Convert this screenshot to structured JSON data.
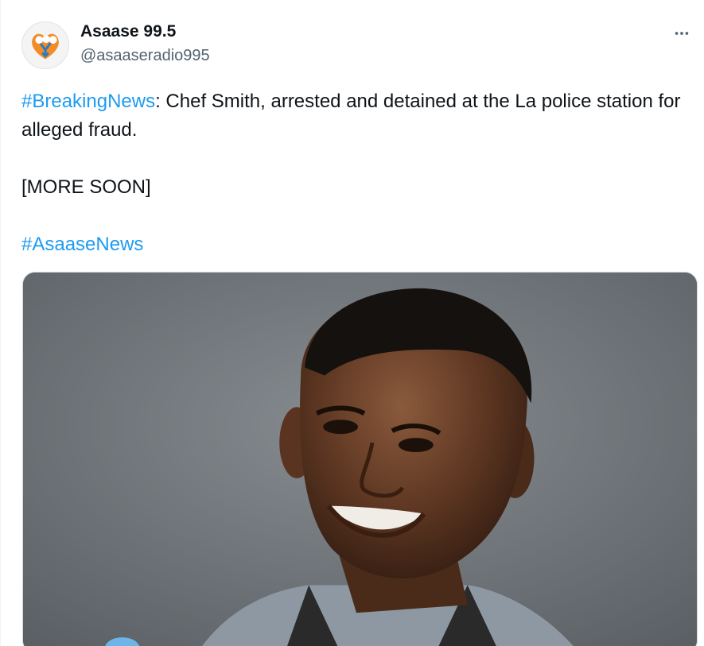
{
  "account": {
    "display_name": "Asaase 99.5",
    "handle": "@asaaseradio995",
    "avatar_icon": "asaase-logo-icon"
  },
  "tweet": {
    "hashtag_breaking": "#BreakingNews",
    "body_line": ": Chef Smith, arrested and detained at the La police station for alleged fraud.",
    "more_soon": "[MORE SOON]",
    "hashtag_news": "#AsaaseNews"
  },
  "menu": {
    "more_icon": "more-horizontal-icon"
  },
  "colors": {
    "link": "#1d9bf0",
    "text": "#0f1419",
    "secondary": "#536471"
  }
}
